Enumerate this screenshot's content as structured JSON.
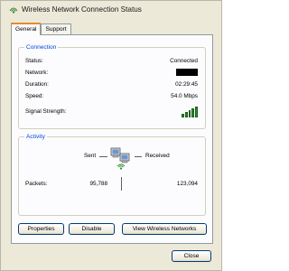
{
  "window": {
    "title": "Wireless Network Connection Status",
    "title_icon": "wireless-network-icon"
  },
  "tabs": [
    {
      "label": "General",
      "active": true
    },
    {
      "label": "Support",
      "active": false
    }
  ],
  "connection": {
    "group_title": "Connection",
    "status_label": "Status:",
    "status_value": "Connected",
    "network_label": "Network:",
    "network_value_redacted": true,
    "duration_label": "Duration:",
    "duration_value": "02:29:45",
    "speed_label": "Speed:",
    "speed_value": "54.0 Mbps",
    "signal_label": "Signal Strength:",
    "signal_bars_lit": 5,
    "signal_bars_total": 5
  },
  "activity": {
    "group_title": "Activity",
    "sent_label": "Sent",
    "received_label": "Received",
    "packets_label": "Packets:",
    "packets_sent": "95,788",
    "packets_received": "123,094",
    "icon": "network-computers-icon"
  },
  "buttons": {
    "properties": "Properties",
    "disable": "Disable",
    "view_networks": "View Wireless Networks",
    "close": "Close"
  },
  "colors": {
    "group_title": "#0046d5",
    "tab_highlight": "#e68b2c",
    "signal_bar": "#2d8a2d"
  }
}
